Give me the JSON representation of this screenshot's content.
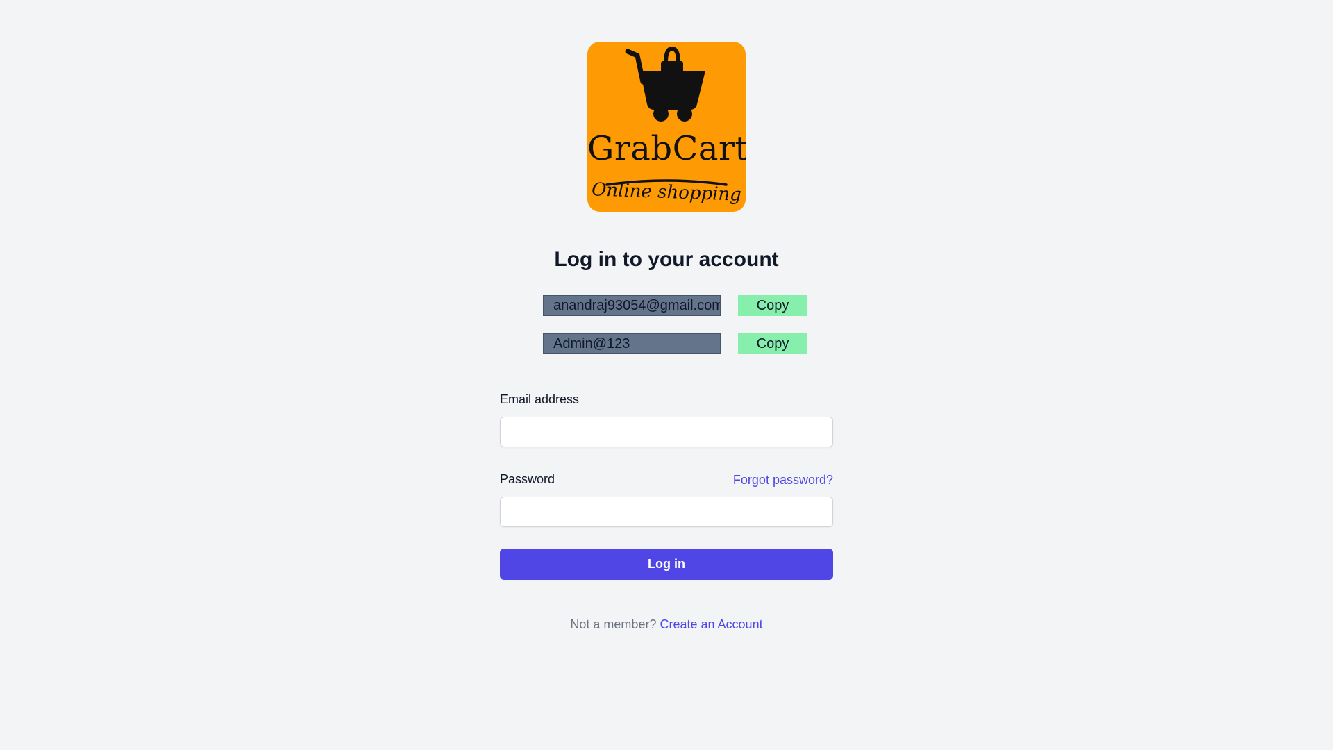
{
  "logo": {
    "brand": "GrabCart",
    "tagline": "Online shopping",
    "background_color": "#fe9a03",
    "icon": "shopping-cart-with-bag-icon"
  },
  "heading": "Log in to your account",
  "credentials": [
    {
      "value": "anandraj93054@gmail.com",
      "copy_label": "Copy"
    },
    {
      "value": "Admin@123",
      "copy_label": "Copy"
    }
  ],
  "form": {
    "email_label": "Email address",
    "email_value": "",
    "password_label": "Password",
    "password_value": "",
    "forgot_label": "Forgot password?",
    "submit_label": "Log in"
  },
  "footer": {
    "prompt": "Not a member?",
    "link_label": "Create an Account"
  },
  "colors": {
    "primary": "#4f46e5",
    "background": "#f3f4f6",
    "copy_button": "#86efac",
    "credential_box": "#64748b"
  }
}
